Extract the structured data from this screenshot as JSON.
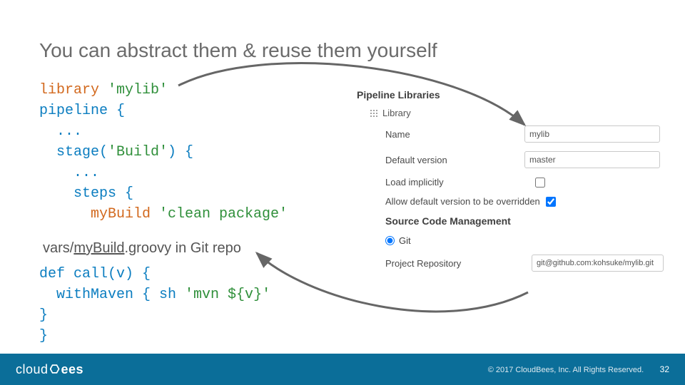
{
  "title": "You can abstract them & reuse them yourself",
  "code1": {
    "l1a": "library",
    "l1b": " 'mylib'",
    "l2": "pipeline {",
    "l3": "  ...",
    "l4a": "  stage(",
    "l4b": "'Build'",
    "l4c": ") {",
    "l5": "    ...",
    "l6": "    steps {",
    "l7a": "      myBuild ",
    "l7b": "'clean package'"
  },
  "caption": {
    "pre": "vars/",
    "mid": "myBuild",
    "post": ".groovy in Git repo"
  },
  "code2": {
    "l1a": "def",
    "l1b": " call(v) {",
    "l2a": "  withMaven { sh ",
    "l2b": "'mvn ${v}'",
    "l3": "}",
    "l4": "}"
  },
  "form": {
    "section1": "Pipeline Libraries",
    "libheader": "Library",
    "name_lbl": "Name",
    "name_val": "mylib",
    "ver_lbl": "Default version",
    "ver_val": "master",
    "load_lbl": "Load implicitly",
    "override_lbl": "Allow default version to be overridden",
    "section2": "Source Code Management",
    "scm_opt": "Git",
    "repo_lbl": "Project Repository",
    "repo_val": "git@github.com:kohsuke/mylib.git"
  },
  "footer": {
    "logo1": "cloud",
    "logo2": "ees",
    "copy": "© 2017 CloudBees, Inc. All Rights Reserved.",
    "page": "32"
  }
}
